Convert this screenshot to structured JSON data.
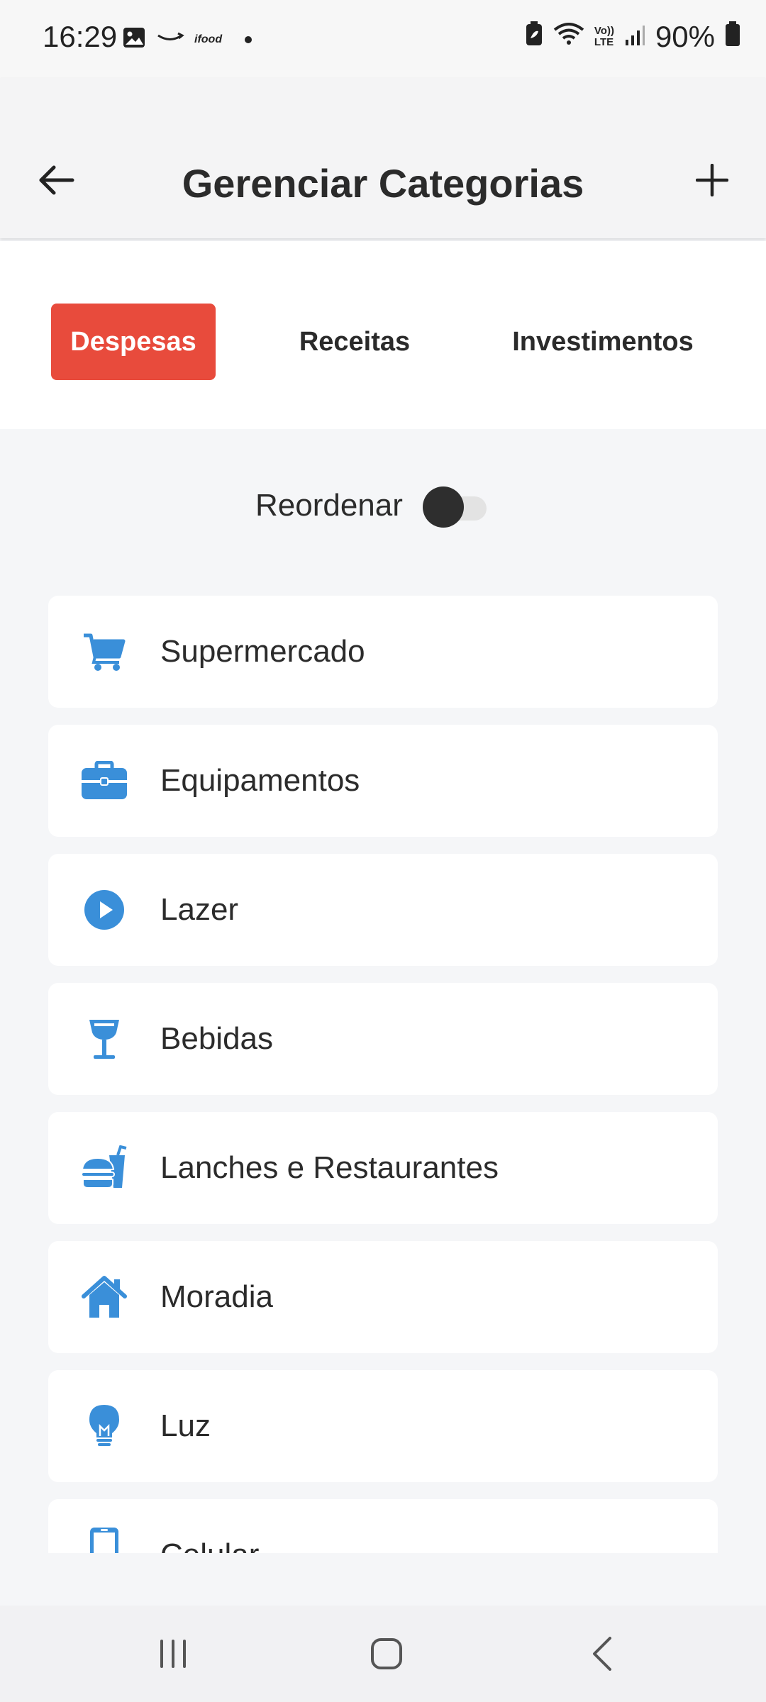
{
  "status_bar": {
    "time": "16:29",
    "battery": "90%",
    "left_icons": [
      "image-icon",
      "amazon-icon",
      "ifood-icon",
      "dot-icon"
    ],
    "right_icons": [
      "battery-saver-icon",
      "wifi-icon",
      "volte-icon",
      "signal-icon",
      "battery-icon"
    ],
    "ifood_label": "ifood",
    "volte_label_top": "Vo))",
    "volte_label_bottom": "LTE"
  },
  "header": {
    "title": "Gerenciar Categorias",
    "back_icon": "arrow-left-icon",
    "add_icon": "plus-icon"
  },
  "tabs": [
    {
      "label": "Despesas",
      "active": true
    },
    {
      "label": "Receitas",
      "active": false
    },
    {
      "label": "Investimentos",
      "active": false
    }
  ],
  "reorder": {
    "label": "Reordenar",
    "enabled": false
  },
  "categories": [
    {
      "label": "Supermercado",
      "icon": "cart-icon"
    },
    {
      "label": "Equipamentos",
      "icon": "briefcase-icon"
    },
    {
      "label": "Lazer",
      "icon": "play-circle-icon"
    },
    {
      "label": "Bebidas",
      "icon": "glass-icon"
    },
    {
      "label": "Lanches e Restaurantes",
      "icon": "burger-drink-icon"
    },
    {
      "label": "Moradia",
      "icon": "home-icon"
    },
    {
      "label": "Luz",
      "icon": "lightbulb-icon"
    },
    {
      "label": "Celular",
      "icon": "mobile-icon"
    }
  ],
  "colors": {
    "accent": "#e84b3c",
    "icon_blue": "#3a8fd9",
    "background": "#f5f6f8"
  },
  "navbar": {
    "icons": [
      "recents-icon",
      "home-nav-icon",
      "back-nav-icon"
    ]
  }
}
